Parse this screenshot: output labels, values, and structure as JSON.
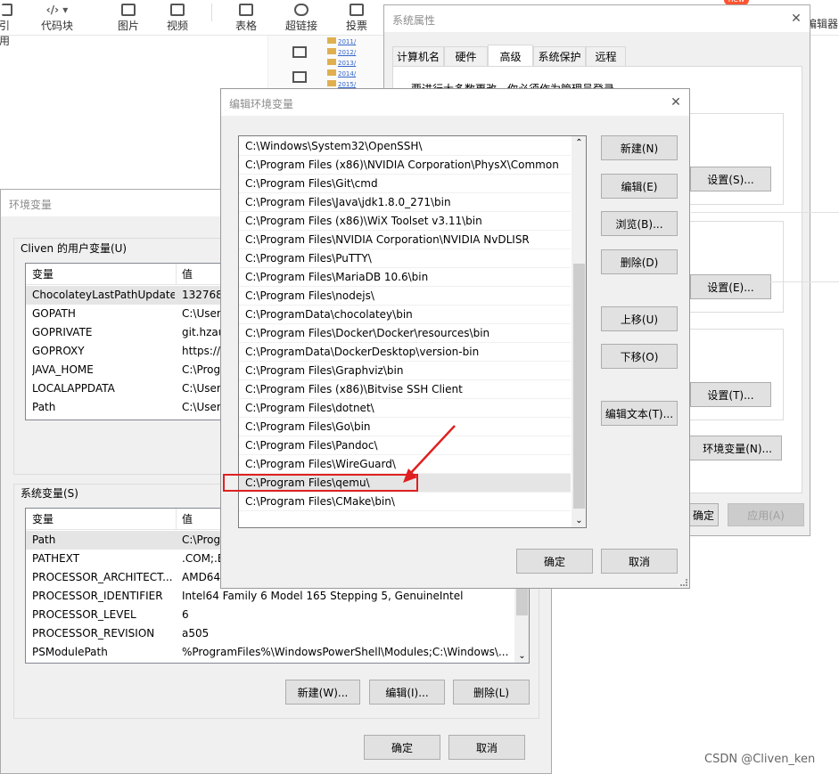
{
  "toolbar": {
    "items": [
      "引用",
      "代码块",
      "图片",
      "视频",
      "表格",
      "超链接",
      "投票"
    ],
    "right_label": "编辑器",
    "badge": "new"
  },
  "archive_items": [
    "2011/",
    "2012/",
    "2013/",
    "2014/",
    "2015/"
  ],
  "env_window": {
    "title": "环境变量",
    "user_group": "Cliven 的用户变量(U)",
    "sys_group": "系统变量(S)",
    "col_var": "变量",
    "col_val": "值",
    "user_vars": [
      {
        "name": "ChocolateyLastPathUpdate",
        "value": "1327683"
      },
      {
        "name": "GOPATH",
        "value": "C:\\Users"
      },
      {
        "name": "GOPRIVATE",
        "value": "git.hzau"
      },
      {
        "name": "GOPROXY",
        "value": "https://g"
      },
      {
        "name": "JAVA_HOME",
        "value": "C:\\Prog"
      },
      {
        "name": "LOCALAPPDATA",
        "value": "C:\\Users"
      },
      {
        "name": "Path",
        "value": "C:\\Users"
      }
    ],
    "sys_vars": [
      {
        "name": "Path",
        "value": "C:\\Prog"
      },
      {
        "name": "PATHEXT",
        "value": ".COM;.E"
      },
      {
        "name": "PROCESSOR_ARCHITECT...",
        "value": "AMD64"
      },
      {
        "name": "PROCESSOR_IDENTIFIER",
        "value": "Intel64 Family 6 Model 165 Stepping 5, GenuineIntel"
      },
      {
        "name": "PROCESSOR_LEVEL",
        "value": "6"
      },
      {
        "name": "PROCESSOR_REVISION",
        "value": "a505"
      },
      {
        "name": "PSModulePath",
        "value": "%ProgramFiles%\\WindowsPowerShell\\Modules;C:\\Windows\\..."
      }
    ],
    "btn_new": "新建(W)...",
    "btn_edit": "编辑(I)...",
    "btn_delete": "删除(L)",
    "btn_ok": "确定",
    "btn_cancel": "取消"
  },
  "sys_props": {
    "title": "系统属性",
    "tabs": [
      "计算机名",
      "硬件",
      "高级",
      "系统保护",
      "远程"
    ],
    "admin_note": "要进行大多数更改，你必须作为管理员登录。",
    "btn_settings_s": "设置(S)...",
    "btn_settings_e": "设置(E)...",
    "btn_settings_t": "设置(T)...",
    "btn_envvars": "环境变量(N)...",
    "btn_ok": "确定",
    "btn_apply": "应用(A)"
  },
  "edit_dialog": {
    "title": "编辑环境变量",
    "paths": [
      "C:\\Windows\\System32\\OpenSSH\\",
      "C:\\Program Files (x86)\\NVIDIA Corporation\\PhysX\\Common",
      "C:\\Program Files\\Git\\cmd",
      "C:\\Program Files\\Java\\jdk1.8.0_271\\bin",
      "C:\\Program Files (x86)\\WiX Toolset v3.11\\bin",
      "C:\\Program Files\\NVIDIA Corporation\\NVIDIA NvDLISR",
      "C:\\Program Files\\PuTTY\\",
      "C:\\Program Files\\MariaDB 10.6\\bin",
      "C:\\Program Files\\nodejs\\",
      "C:\\ProgramData\\chocolatey\\bin",
      "C:\\Program Files\\Docker\\Docker\\resources\\bin",
      "C:\\ProgramData\\DockerDesktop\\version-bin",
      "C:\\Program Files\\Graphviz\\bin",
      "C:\\Program Files (x86)\\Bitvise SSH Client",
      "C:\\Program Files\\dotnet\\",
      "C:\\Program Files\\Go\\bin",
      "C:\\Program Files\\Pandoc\\",
      "C:\\Program Files\\WireGuard\\",
      "C:\\Program Files\\qemu\\",
      "C:\\Program Files\\CMake\\bin\\"
    ],
    "btn_new": "新建(N)",
    "btn_edit": "编辑(E)",
    "btn_browse": "浏览(B)...",
    "btn_delete": "删除(D)",
    "btn_up": "上移(U)",
    "btn_down": "下移(O)",
    "btn_edit_text": "编辑文本(T)...",
    "btn_ok": "确定",
    "btn_cancel": "取消"
  },
  "watermark": "CSDN @Cliven_ken",
  "colors": {
    "selection": "#e5e5e5",
    "accent": "#0078d7",
    "annotation": "#e02020"
  }
}
